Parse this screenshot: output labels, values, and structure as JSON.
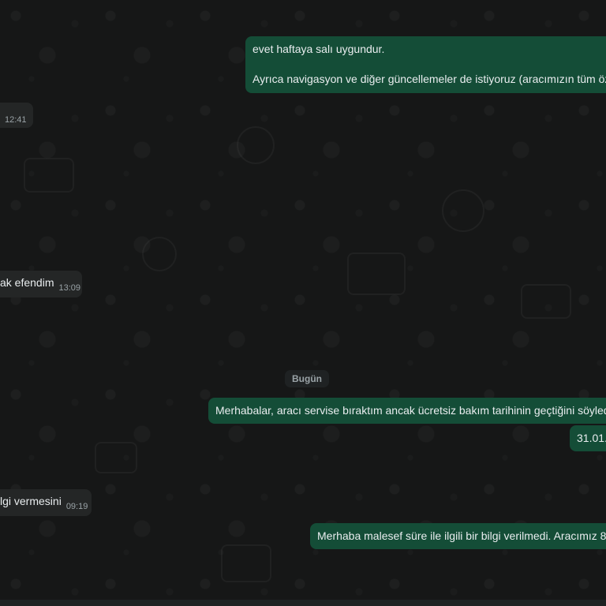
{
  "messages": [
    {
      "direction": "outgoing",
      "line1": "evet haftaya salı uygundur.",
      "line2": "Ayrıca navigasyon ve diğer güncellemeler de istiyoruz (aracımızın tüm öz"
    },
    {
      "direction": "incoming",
      "text": "",
      "time": "12:41"
    },
    {
      "direction": "incoming",
      "text": "ak efendim",
      "time": "13:09"
    },
    {
      "direction": "outgoing",
      "text": "Merhabalar, aracı servise bıraktım ancak ücretsiz bakım tarihinin geçtiğini söyled"
    },
    {
      "direction": "outgoing",
      "text": "31.01."
    },
    {
      "direction": "incoming",
      "text": "lgi vermesini",
      "time": "09:19"
    },
    {
      "direction": "outgoing",
      "text": "Merhaba malesef süre ile ilgili bir bilgi verilmedi. Aracımız 8"
    }
  ],
  "day_separator": "Bugün",
  "colors": {
    "outgoing_bubble": "#144d37",
    "incoming_bubble": "#242626",
    "background": "#161717",
    "text": "#e9edef",
    "timestamp": "#9aa3a7"
  }
}
